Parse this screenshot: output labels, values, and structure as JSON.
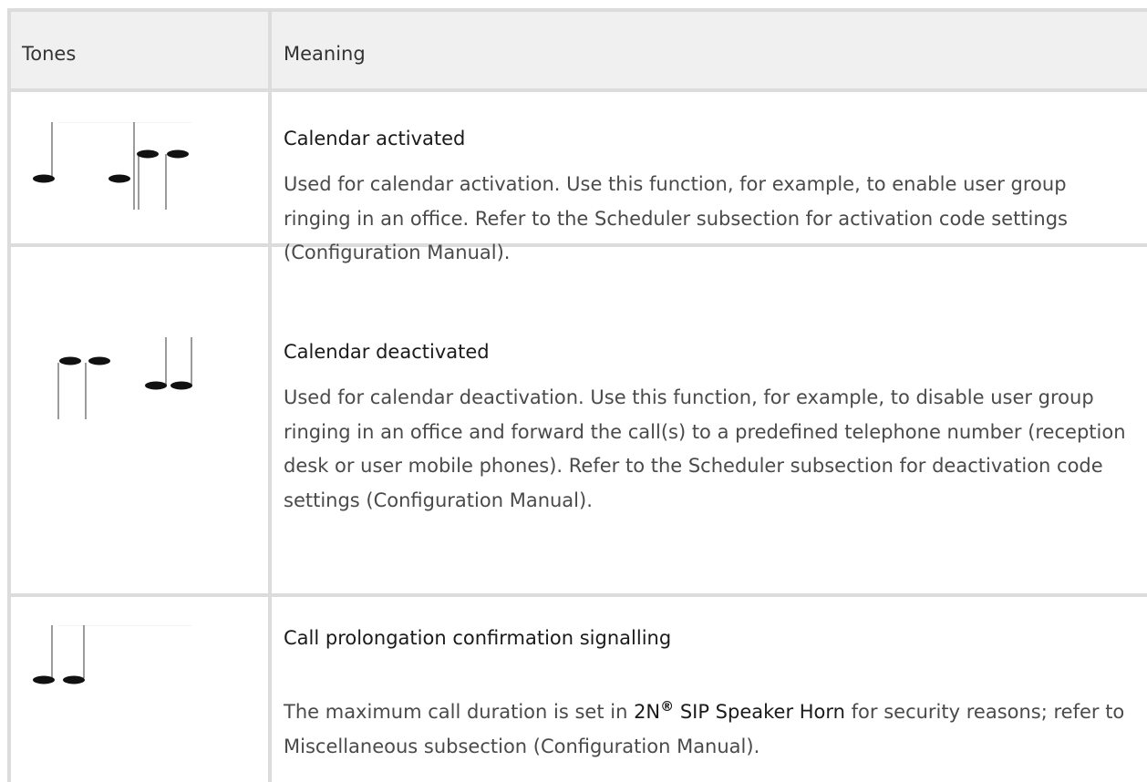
{
  "table": {
    "headers": {
      "tones": "Tones",
      "meaning": "Meaning"
    },
    "rows": [
      {
        "tone_icon": "rising-notes-icon",
        "title": "Calendar activated",
        "description": "Used for calendar activation. Use this function, for example, to enable user group ringing in an office. Refer to the Scheduler subsection for activation code settings (Configuration Manual)."
      },
      {
        "tone_icon": "falling-notes-icon",
        "title": "Calendar deactivated",
        "description": "Used for calendar deactivation. Use this function, for example, to disable user group ringing in an office and forward the call(s) to a predefined telephone number (reception desk or user mobile phones). Refer to the Scheduler subsection for deactivation code settings (Configuration Manual)."
      },
      {
        "tone_icon": "two-low-notes-icon",
        "title": "Call prolongation confirmation signalling",
        "description_parts": {
          "before": "The maximum call duration is set in ",
          "product_prefix": "2N",
          "registered_mark": "®",
          "product_name": " SIP Speaker Horn",
          "after": " for security reasons; refer to Miscellaneous subsection (Configuration Manual)."
        }
      }
    ]
  }
}
